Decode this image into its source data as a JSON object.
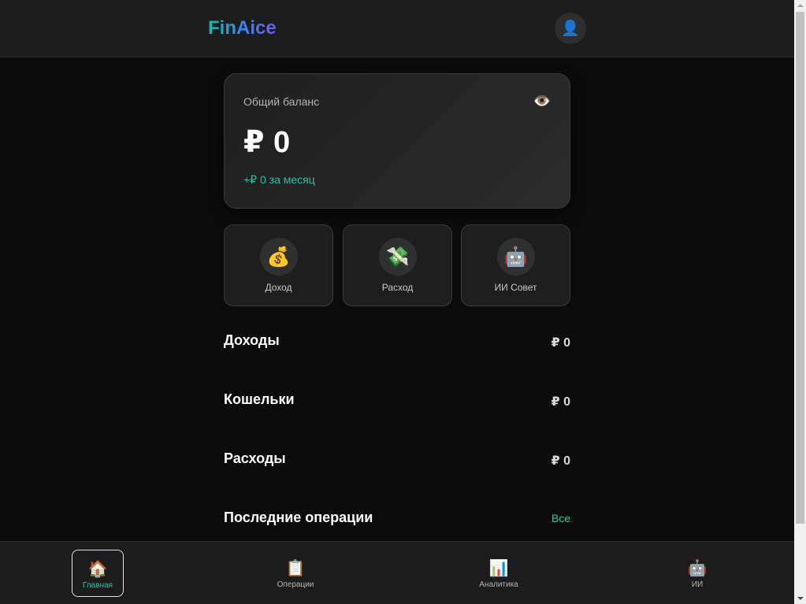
{
  "header": {
    "logo": "FinAice",
    "avatar_icon": "user-icon"
  },
  "balance": {
    "label": "Общий баланс",
    "amount": "₽ 0",
    "change": "+₽ 0 за месяц",
    "eye_icon": "eye-icon"
  },
  "actions": [
    {
      "label": "Доход",
      "icon": "money-bag-icon"
    },
    {
      "label": "Расход",
      "icon": "money-wings-icon"
    },
    {
      "label": "ИИ Совет",
      "icon": "robot-icon"
    }
  ],
  "sections": {
    "income": {
      "title": "Доходы",
      "value": "₽ 0"
    },
    "wallets": {
      "title": "Кошельки",
      "value": "₽ 0"
    },
    "expenses": {
      "title": "Расходы",
      "value": "₽ 0"
    },
    "recent": {
      "title": "Последние операции",
      "link": "Все"
    }
  },
  "nav": [
    {
      "label": "Главная",
      "icon": "home-icon",
      "active": true
    },
    {
      "label": "Операции",
      "icon": "clipboard-icon",
      "active": false
    },
    {
      "label": "Аналитика",
      "icon": "bar-chart-icon",
      "active": false
    },
    {
      "label": "ИИ",
      "icon": "robot-icon",
      "active": false
    }
  ],
  "colors": {
    "accent": "#22c5a4",
    "background": "#0b0b0b",
    "surface": "#1c1c1c"
  }
}
